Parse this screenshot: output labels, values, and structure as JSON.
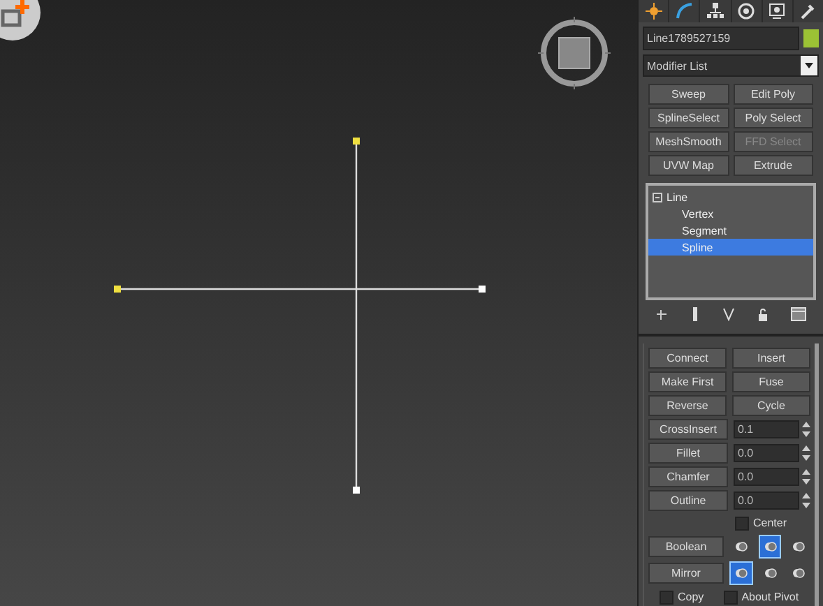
{
  "viewport": {
    "vertices": [
      {
        "selected": true
      },
      {
        "selected": true
      },
      {
        "selected": false
      },
      {
        "selected": false
      }
    ]
  },
  "command_panel": {
    "object_name": "Line1789527159",
    "modifier_list": "Modifier List",
    "modifier_buttons": [
      {
        "label": "Sweep",
        "disabled": false
      },
      {
        "label": "Edit Poly",
        "disabled": false
      },
      {
        "label": "SplineSelect",
        "disabled": false
      },
      {
        "label": "Poly Select",
        "disabled": false
      },
      {
        "label": "MeshSmooth",
        "disabled": false
      },
      {
        "label": "FFD Select",
        "disabled": true
      },
      {
        "label": "UVW Map",
        "disabled": false
      },
      {
        "label": "Extrude",
        "disabled": false
      }
    ],
    "stack": [
      {
        "label": "Line",
        "expanded": true,
        "selected": false,
        "children": [
          {
            "label": "Vertex",
            "selected": false
          },
          {
            "label": "Segment",
            "selected": false
          },
          {
            "label": "Spline",
            "selected": true
          }
        ]
      }
    ],
    "rollout": [
      {
        "kind": "pair",
        "left": "Connect",
        "right": "Insert"
      },
      {
        "kind": "pair",
        "left": "Make First",
        "right": "Fuse"
      },
      {
        "kind": "pair",
        "left": "Reverse",
        "right": "Cycle"
      },
      {
        "kind": "spinner",
        "label": "CrossInsert",
        "value": "0.1"
      },
      {
        "kind": "spinner",
        "label": "Fillet",
        "value": "0.0"
      },
      {
        "kind": "spinner",
        "label": "Chamfer",
        "value": "0.0"
      },
      {
        "kind": "spinner",
        "label": "Outline",
        "value": "0.0"
      },
      {
        "kind": "check",
        "label": "Center",
        "checked": false
      },
      {
        "kind": "icons",
        "label": "Boolean",
        "options": [
          {
            "selected": false
          },
          {
            "selected": true
          },
          {
            "selected": false
          }
        ]
      },
      {
        "kind": "icons",
        "label": "Mirror",
        "options": [
          {
            "selected": true
          },
          {
            "selected": false
          },
          {
            "selected": false
          }
        ]
      },
      {
        "kind": "checks",
        "items": [
          {
            "label": "Copy",
            "checked": false
          },
          {
            "label": "About Pivot",
            "checked": false
          }
        ]
      }
    ]
  }
}
